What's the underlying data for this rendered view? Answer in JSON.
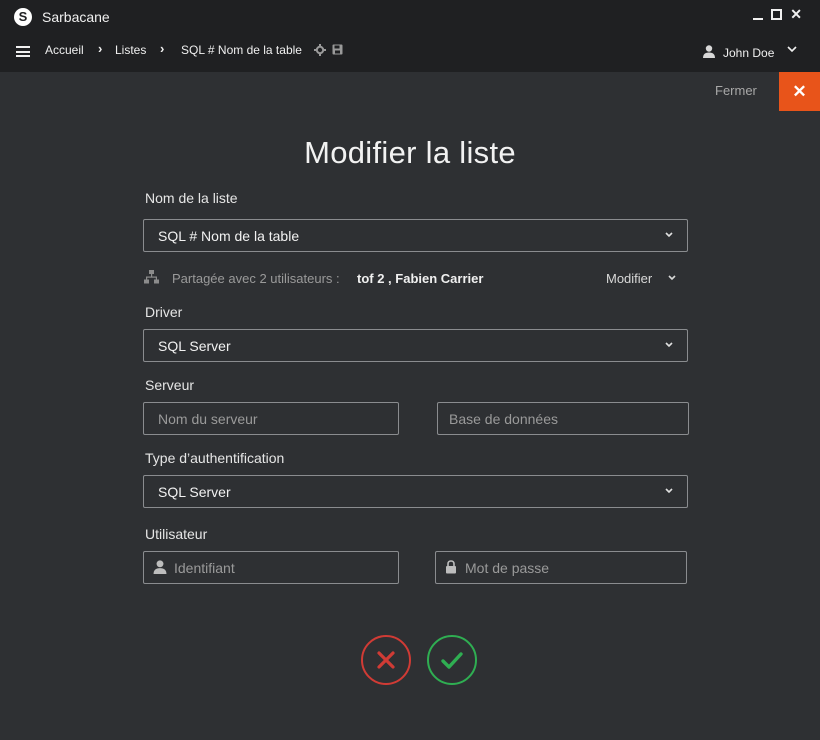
{
  "app": {
    "title": "Sarbacane",
    "logo_letter": "S"
  },
  "window": {
    "minimize_icon": "minimize-icon",
    "maximize_icon": "maximize-icon",
    "close_icon": "close-icon",
    "close_glyph": "✕"
  },
  "nav": {
    "menu_icon": "hamburger-icon",
    "breadcrumb": [
      "Accueil",
      "Listes",
      "SQL # Nom de la table"
    ],
    "separator": "›",
    "settings_icon": "gear-icon",
    "save_icon": "save-icon",
    "user": "John Doe"
  },
  "close": {
    "label": "Fermer",
    "glyph": "✕"
  },
  "form": {
    "title": "Modifier la liste",
    "list_name": {
      "label": "Nom de la liste",
      "value": "SQL # Nom de la table"
    },
    "shared": {
      "text": "Partagée avec 2 utilisateurs :",
      "users": "tof 2 , Fabien Carrier",
      "modify": "Modifier"
    },
    "driver": {
      "label": "Driver",
      "value": "SQL Server"
    },
    "server": {
      "label": "Serveur",
      "host_placeholder": "Nom du serveur",
      "db_placeholder": "Base de données"
    },
    "auth": {
      "label": "Type d’authentification",
      "value": "SQL Server"
    },
    "user": {
      "label": "Utilisateur",
      "login_placeholder": "Identifiant",
      "password_placeholder": "Mot de passe"
    }
  },
  "actions": {
    "cancel_icon": "cross-icon",
    "confirm_icon": "check-icon"
  },
  "colors": {
    "accent": "#e8541a",
    "cancel": "#d03b35",
    "confirm": "#2fae52",
    "background": "#2e3033",
    "bar": "#1f2022"
  }
}
